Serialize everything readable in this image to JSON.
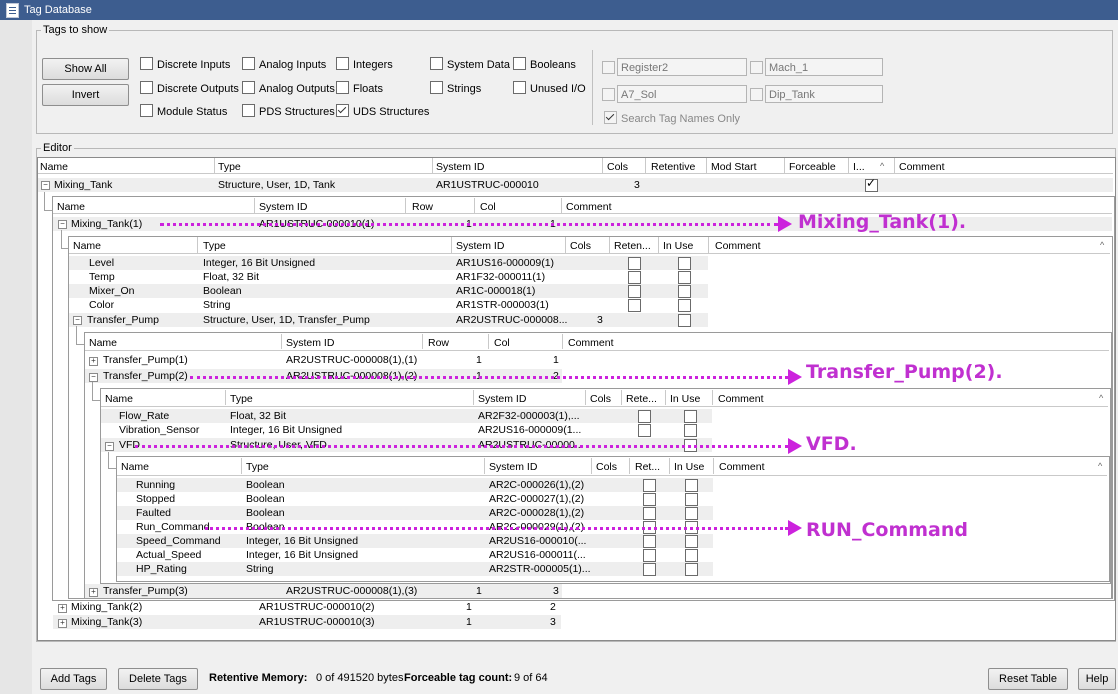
{
  "window": {
    "title": "Tag Database"
  },
  "tags_to_show": {
    "legend": "Tags to show",
    "show_all": "Show All",
    "invert": "Invert",
    "checkboxes": [
      {
        "label": "Discrete Inputs",
        "checked": false
      },
      {
        "label": "Analog Inputs",
        "checked": false
      },
      {
        "label": "Integers",
        "checked": false
      },
      {
        "label": "System Data",
        "checked": false
      },
      {
        "label": "Booleans",
        "checked": false
      },
      {
        "label": "Discrete Outputs",
        "checked": false
      },
      {
        "label": "Analog Outputs",
        "checked": false
      },
      {
        "label": "Floats",
        "checked": false
      },
      {
        "label": "Strings",
        "checked": false
      },
      {
        "label": "Unused I/O",
        "checked": false
      },
      {
        "label": "Module Status",
        "checked": false
      },
      {
        "label": "PDS Structures",
        "checked": false
      },
      {
        "label": "UDS Structures",
        "checked": true
      }
    ],
    "filters": [
      {
        "value": "Register2",
        "checked": false
      },
      {
        "value": "Mach_1",
        "checked": false
      },
      {
        "value": "A7_Sol",
        "checked": false
      },
      {
        "value": "Dip_Tank",
        "checked": false
      }
    ],
    "search_names_only": {
      "label": "Search Tag Names Only",
      "checked": true
    }
  },
  "editor": {
    "legend": "Editor",
    "level0_headers": [
      "Name",
      "Type",
      "System ID",
      "Cols",
      "Retentive",
      "Mod Start",
      "Forceable",
      "I...",
      "Comment"
    ],
    "mixing_tank": {
      "name": "Mixing_Tank",
      "type": "Structure, User, 1D, Tank",
      "system_id": "AR1USTRUC-000010",
      "cols": "3",
      "in_use": true
    },
    "level1_headers": [
      "Name",
      "System ID",
      "Row",
      "Col",
      "Comment"
    ],
    "mixing_tank_1": {
      "name": "Mixing_Tank(1)",
      "system_id": "AR1USTRUC-000010(1)",
      "row": "1",
      "col": "1"
    },
    "level2_headers": [
      "Name",
      "Type",
      "System ID",
      "Cols",
      "Reten...",
      "In Use",
      "Comment"
    ],
    "level2_rows": [
      {
        "name": "Level",
        "type": "Integer, 16 Bit Unsigned",
        "system_id": "AR1US16-000009(1)"
      },
      {
        "name": "Temp",
        "type": "Float, 32 Bit",
        "system_id": "AR1F32-000011(1)"
      },
      {
        "name": "Mixer_On",
        "type": "Boolean",
        "system_id": "AR1C-000018(1)"
      },
      {
        "name": "Color",
        "type": "String",
        "system_id": "AR1STR-000003(1)"
      }
    ],
    "transfer_pump": {
      "name": "Transfer_Pump",
      "type": "Structure, User, 1D, Transfer_Pump",
      "system_id": "AR2USTRUC-000008...",
      "cols": "3"
    },
    "level3_headers": [
      "Name",
      "System ID",
      "Row",
      "Col",
      "Comment"
    ],
    "transfer_pump_1": {
      "name": "Transfer_Pump(1)",
      "system_id": "AR2USTRUC-000008(1),(1)",
      "row": "1",
      "col": "1"
    },
    "transfer_pump_2": {
      "name": "Transfer_Pump(2)",
      "system_id": "AR2USTRUC-000008(1),(2)",
      "row": "1",
      "col": "2"
    },
    "level4_headers": [
      "Name",
      "Type",
      "System ID",
      "Cols",
      "Rete...",
      "In Use",
      "Comment"
    ],
    "level4_rows": [
      {
        "name": "Flow_Rate",
        "type": "Float, 32 Bit",
        "system_id": "AR2F32-000003(1),..."
      },
      {
        "name": "Vibration_Sensor",
        "type": "Integer, 16 Bit Unsigned",
        "system_id": "AR2US16-000009(1..."
      }
    ],
    "vfd": {
      "name": "VFD",
      "type": "Structure, User, VFD",
      "system_id": "AR2USTRUC-00000..."
    },
    "level5_headers": [
      "Name",
      "Type",
      "System ID",
      "Cols",
      "Ret...",
      "In Use",
      "Comment"
    ],
    "level5_rows": [
      {
        "name": "Running",
        "type": "Boolean",
        "system_id": "AR2C-000026(1),(2)"
      },
      {
        "name": "Stopped",
        "type": "Boolean",
        "system_id": "AR2C-000027(1),(2)"
      },
      {
        "name": "Faulted",
        "type": "Boolean",
        "system_id": "AR2C-000028(1),(2)"
      },
      {
        "name": "Run_Command",
        "type": "Boolean",
        "system_id": "AR2C-000029(1),(2)"
      },
      {
        "name": "Speed_Command",
        "type": "Integer, 16 Bit Unsigned",
        "system_id": "AR2US16-000010(..."
      },
      {
        "name": "Actual_Speed",
        "type": "Integer, 16 Bit Unsigned",
        "system_id": "AR2US16-000011(..."
      },
      {
        "name": "HP_Rating",
        "type": "String",
        "system_id": "AR2STR-000005(1)..."
      }
    ],
    "transfer_pump_3": {
      "name": "Transfer_Pump(3)",
      "system_id": "AR2USTRUC-000008(1),(3)",
      "row": "1",
      "col": "3"
    },
    "mixing_tank_2": {
      "name": "Mixing_Tank(2)",
      "system_id": "AR1USTRUC-000010(2)",
      "row": "1",
      "col": "2"
    },
    "mixing_tank_3": {
      "name": "Mixing_Tank(3)",
      "system_id": "AR1USTRUC-000010(3)",
      "row": "1",
      "col": "3"
    }
  },
  "callouts": {
    "mixing_tank_1": "Mixing_Tank(1).",
    "transfer_pump_2": "Transfer_Pump(2).",
    "vfd": "VFD.",
    "run_command": "RUN_Command"
  },
  "footer": {
    "add_tags": "Add Tags",
    "delete_tags": "Delete Tags",
    "retentive_label": "Retentive Memory:",
    "retentive_value": "0 of 491520 bytes",
    "forceable_label": "Forceable tag count:",
    "forceable_value": "9 of 64",
    "reset_table": "Reset Table",
    "help": "Help"
  },
  "colors": {
    "titlebar": "#3d5d8f",
    "callout": "#c030d0"
  }
}
